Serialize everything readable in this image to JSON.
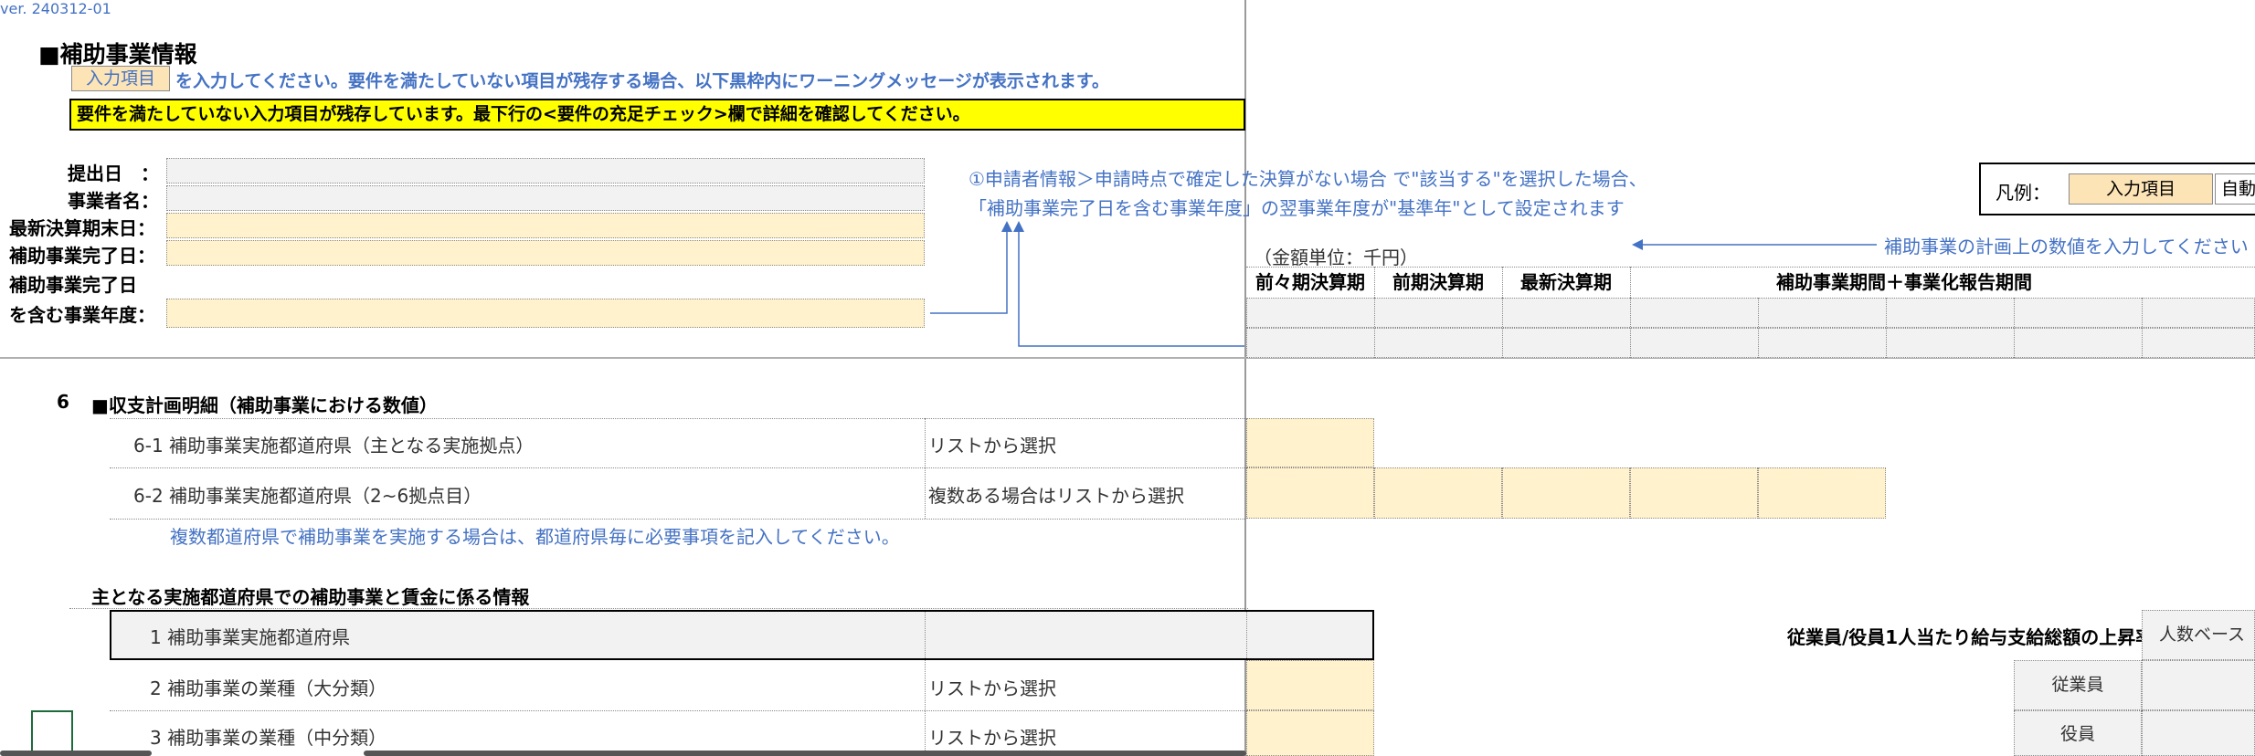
{
  "version": "ver. 240312-01",
  "section_title": "■補助事業情報",
  "instruction": {
    "badge": "入力項目",
    "text": "を入力してください。要件を満たしていない項目が残存する場合、以下黒枠内にワーニングメッセージが表示されます。"
  },
  "warning": "要件を満たしていない入力項目が残存しています。最下行の<要件の充足チェック>欄で詳細を確認してください。",
  "form": {
    "labels": [
      "提出日　：",
      "事業者名：",
      "最新決算期末日：",
      "補助事業完了日：",
      "補助事業完了日",
      "を含む事業年度："
    ]
  },
  "note": {
    "line1": "①申請者情報＞申請時点で確定した決算がない場合 で\"該当する\"を選択した場合、",
    "line2": "「補助事業完了日を含む事業年度」の翌事業年度が\"基準年\"として設定されます"
  },
  "legend": {
    "label": "凡例：",
    "input_item": "入力項目",
    "next": "自動"
  },
  "plan_note": "補助事業の計画上の数値を入力してください",
  "unit": "（金額単位：千円）",
  "headers": {
    "col1": "前々期決算期",
    "col2": "前期決算期",
    "col3": "最新決算期",
    "col4": "補助事業期間＋事業化報告期間"
  },
  "section6": {
    "number": "6",
    "title": "■収支計画明細（補助事業における数値）",
    "row1": {
      "label": "6-1 補助事業実施都道府県（主となる実施拠点）",
      "hint": "リストから選択"
    },
    "row2": {
      "label": "6-2 補助事業実施都道府県（2~6拠点目）",
      "hint": "複数ある場合はリストから選択"
    },
    "note": "複数都道府県で補助事業を実施する場合は、都道府県毎に必要事項を記入してください。",
    "sub_title": "主となる実施都道府県での補助事業と賃金に係る情報",
    "items": [
      {
        "label": "1 補助事業実施都道府県",
        "hint": ""
      },
      {
        "label": "2 補助事業の業種（大分類）",
        "hint": "リストから選択"
      },
      {
        "label": "3 補助事業の業種（中分類）",
        "hint": "リストから選択"
      }
    ],
    "right_label": "従業員/役員1人当たり給与支給総額の上昇率",
    "right_badge": "人数ベース",
    "right_row1": "従業員",
    "right_row2": "役員"
  }
}
